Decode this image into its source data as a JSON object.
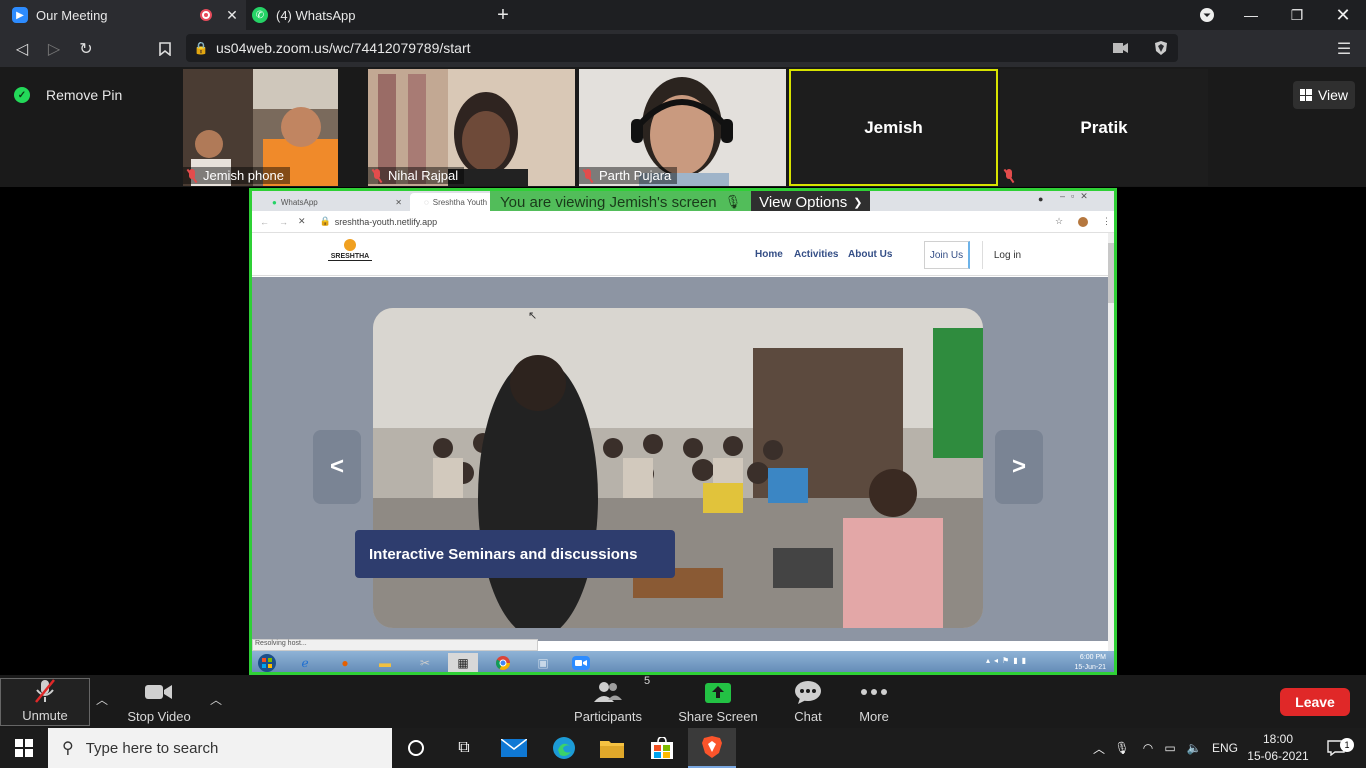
{
  "browser": {
    "tabs": [
      {
        "label": "Our Meeting",
        "active": true,
        "icon": "zoom-icon"
      },
      {
        "label": "(4) WhatsApp",
        "active": false,
        "icon": "whatsapp-icon"
      }
    ],
    "url": "us04web.zoom.us/wc/74412079789/start"
  },
  "zoom": {
    "remove_pin_label": "Remove Pin",
    "view_label": "View",
    "participants": [
      {
        "name": "Jemish phone",
        "muted": true
      },
      {
        "name": "Nihal Rajpal",
        "muted": true
      },
      {
        "name": "Parth Pujara",
        "muted": true
      },
      {
        "name": "Jemish",
        "muted": false
      },
      {
        "name": "Pratik",
        "muted": true
      }
    ],
    "viewing_text": "You are viewing Jemish's screen",
    "view_options_label": "View Options",
    "controls": {
      "unmute": "Unmute",
      "stop_video": "Stop Video",
      "participants": "Participants",
      "participants_count": "5",
      "share_screen": "Share Screen",
      "chat": "Chat",
      "more": "More",
      "leave": "Leave"
    }
  },
  "shared": {
    "tabs": [
      "WhatsApp",
      "Sreshtha Youth"
    ],
    "url": "sreshtha-youth.netlify.app",
    "logo_text": "SRESHTHA",
    "nav": [
      "Home",
      "Activities",
      "About Us"
    ],
    "join_label": "Join Us",
    "login_label": "Log in",
    "prev_label": "<",
    "next_label": ">",
    "caption": "Interactive Seminars and discussions",
    "status": "Resolving host...",
    "clock_time": "6:00 PM",
    "clock_date": "15-Jun-21"
  },
  "taskbar": {
    "search_placeholder": "Type here to search",
    "lang": "ENG",
    "time": "18:00",
    "date": "15-06-2021",
    "notifications": "1"
  }
}
